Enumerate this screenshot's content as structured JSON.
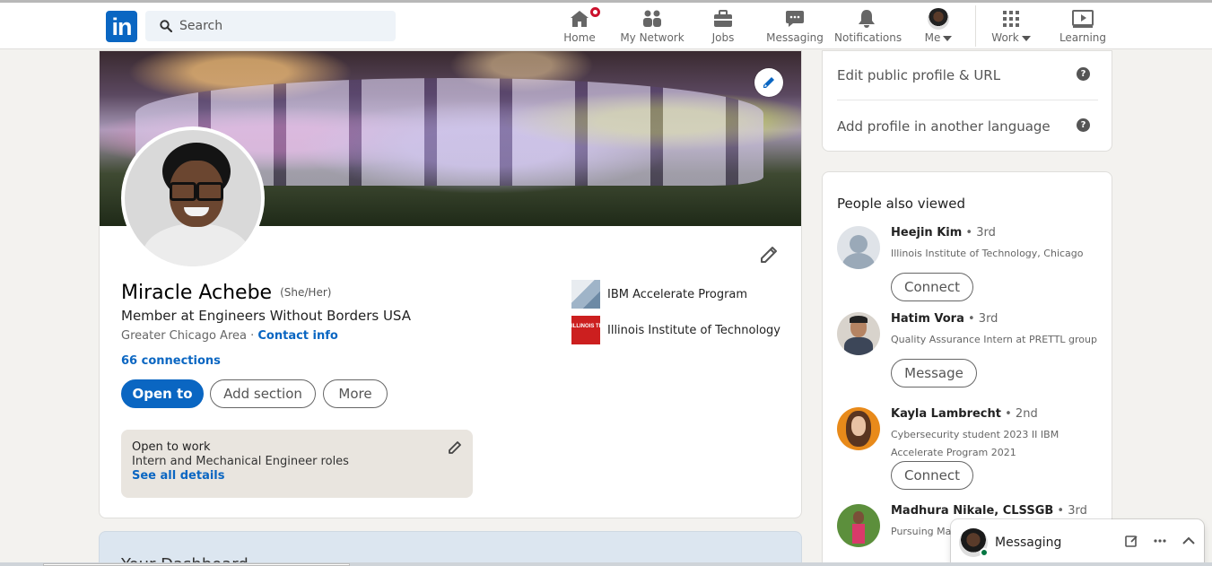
{
  "nav": {
    "logo": "in",
    "search_placeholder": "Search",
    "items": [
      {
        "label": "Home",
        "icon": "home-icon"
      },
      {
        "label": "My Network",
        "icon": "network-icon"
      },
      {
        "label": "Jobs",
        "icon": "briefcase-icon"
      },
      {
        "label": "Messaging",
        "icon": "chat-icon"
      },
      {
        "label": "Notifications",
        "icon": "bell-icon"
      },
      {
        "label": "Me",
        "icon": "avatar"
      },
      {
        "label": "Work",
        "icon": "grid-icon"
      },
      {
        "label": "Learning",
        "icon": "play-icon"
      }
    ]
  },
  "profile": {
    "name": "Miracle Achebe",
    "pronouns": "(She/Her)",
    "headline": "Member at Engineers Without Borders USA",
    "location": "Greater Chicago Area",
    "location_sep": " · ",
    "contact_info": "Contact info",
    "connections": "66 connections",
    "buttons": {
      "open_to": "Open to",
      "add_section": "Add section",
      "more": "More"
    },
    "orgs": [
      {
        "name": "IBM Accelerate Program"
      },
      {
        "name": "Illinois Institute of Technology",
        "logo_text": "ILLINOIS TECH"
      }
    ],
    "open_to_work": {
      "title": "Open to work",
      "roles": "Intern and Mechanical Engineer roles",
      "link": "See all details"
    }
  },
  "dashboard": {
    "title": "Your Dashboard"
  },
  "rail": {
    "edit_public_profile": "Edit public profile & URL",
    "add_language": "Add profile in another language",
    "help_glyph": "?",
    "people_also_viewed": "People also viewed",
    "people": [
      {
        "name": "Heejin Kim",
        "degree": " • 3rd",
        "desc": "Illinois Institute of Technology, Chicago",
        "action": "Connect"
      },
      {
        "name": "Hatim Vora",
        "degree": " • 3rd",
        "desc": "Quality Assurance Intern at PRETTL group",
        "action": "Message"
      },
      {
        "name": "Kayla Lambrecht",
        "degree": " • 2nd",
        "desc": "Cybersecurity student 2023 II IBM Accelerate Program 2021",
        "action": "Connect"
      },
      {
        "name": "Madhura Nikale, CLSSGB",
        "degree": " • 3rd",
        "desc": "Pursuing Mas... and Operatio...",
        "action": ""
      }
    ]
  },
  "messaging": {
    "label": "Messaging"
  },
  "colors": {
    "brand": "#0a66c2",
    "background": "#f3f2ef",
    "notification_badge": "#cb112d"
  }
}
